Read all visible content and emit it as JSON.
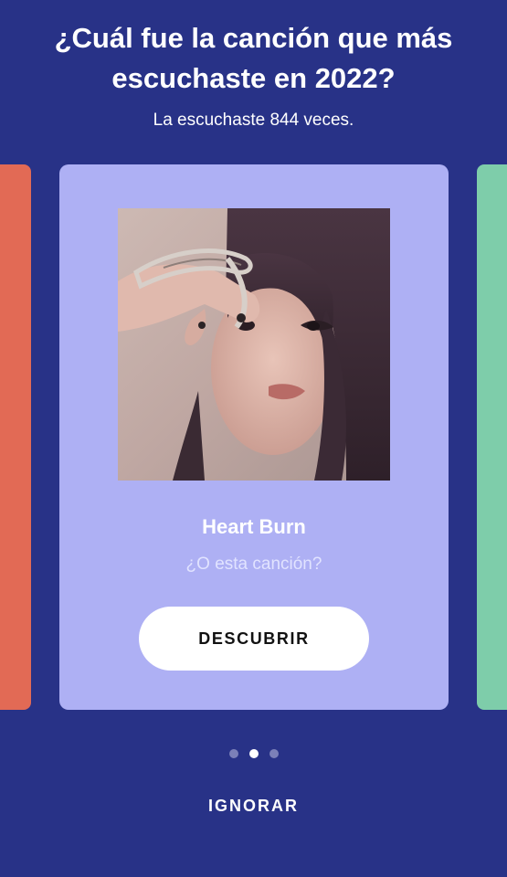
{
  "header": {
    "title": "¿Cuál fue la canción que más escuchaste en 2022?",
    "subtitle": "La escuchaste 844 veces."
  },
  "carousel": {
    "left_card_color": "#e26a55",
    "card_color": "#aeb0f4",
    "right_card_color": "#7ecdaa",
    "song_title": "Heart Burn",
    "question": "¿O esta canción?",
    "discover_label": "DESCUBRIR",
    "page_count": 3,
    "active_page": 2
  },
  "footer": {
    "ignore_label": "IGNORAR"
  },
  "colors": {
    "background": "#283287",
    "button_text": "#121212"
  }
}
